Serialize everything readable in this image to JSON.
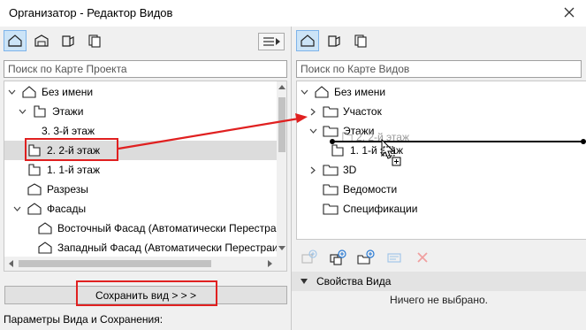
{
  "window": {
    "title": "Организатор - Редактор Видов"
  },
  "left": {
    "search_placeholder": "Поиск по Карте Проекта",
    "tree": [
      {
        "label": "Без имени",
        "icon": "project-house-icon"
      },
      {
        "label": "Этажи",
        "icon": "story-icon"
      },
      {
        "label": "3. 3-й этаж",
        "icon": "story-icon"
      },
      {
        "label": "2. 2-й этаж",
        "icon": "story-icon"
      },
      {
        "label": "1. 1-й этаж",
        "icon": "story-icon"
      },
      {
        "label": "Разрезы",
        "icon": "section-icon"
      },
      {
        "label": "Фасады",
        "icon": "elevation-icon"
      },
      {
        "label": "Восточный Фасад (Автоматически Перестраив",
        "icon": "elevation-icon"
      },
      {
        "label": "Западный Фасад (Автоматически Перестраив",
        "icon": "elevation-icon"
      }
    ],
    "save_button": "Сохранить вид > > >",
    "params_label": "Параметры Вида и Сохранения:"
  },
  "right": {
    "search_placeholder": "Поиск по Карте Видов",
    "tree": [
      {
        "label": "Без имени",
        "icon": "project-house-icon"
      },
      {
        "label": "Участок",
        "icon": "folder-icon"
      },
      {
        "label": "Этажи",
        "icon": "folder-icon"
      },
      {
        "label": "1. 1-й этаж",
        "icon": "story-icon"
      },
      {
        "label": "3D",
        "icon": "folder-icon"
      },
      {
        "label": "Ведомости",
        "icon": "folder-icon"
      },
      {
        "label": "Спецификации",
        "icon": "folder-icon"
      }
    ],
    "drag_ghost": "2. 2-й этаж",
    "properties_title": "Свойства Вида",
    "nothing_selected": "Ничего не выбрано."
  },
  "colors": {
    "selection_border": "#7eb4ea",
    "selection_fill": "#cce4f7",
    "highlight_red": "#e02020",
    "row_selected": "#dcdcdc"
  }
}
